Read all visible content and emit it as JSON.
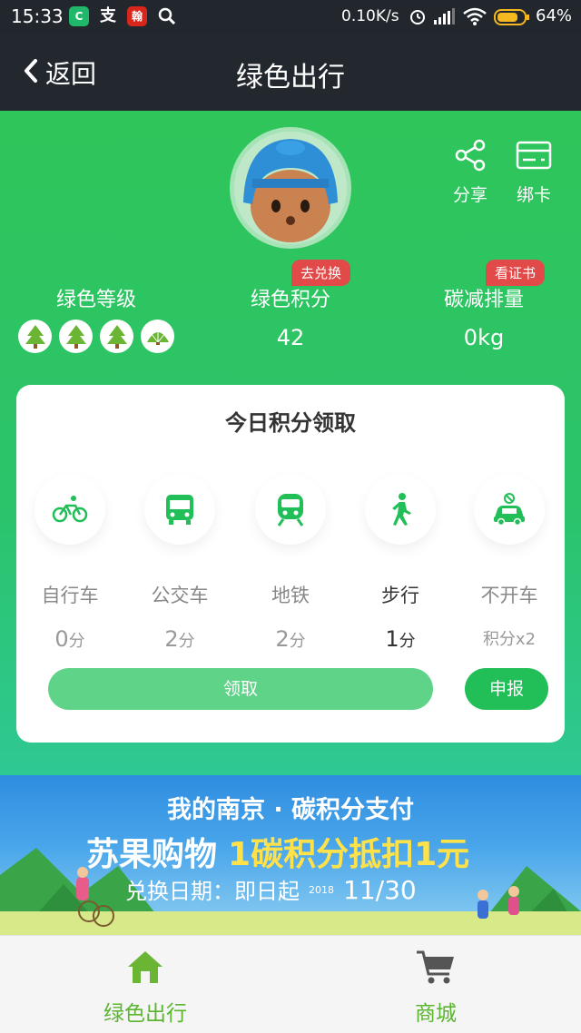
{
  "status_bar": {
    "time": "15:33",
    "app_icons": [
      "C",
      "支",
      "翰"
    ],
    "network_speed": "0.10K/s",
    "battery": "64%"
  },
  "header": {
    "back_label": "返回",
    "title": "绿色出行"
  },
  "profile": {
    "share_label": "分享",
    "bind_card_label": "绑卡"
  },
  "stats": {
    "level_label": "绿色等级",
    "points_label": "绿色积分",
    "points_value": "42",
    "points_tag": "去兑换",
    "carbon_label": "碳减排量",
    "carbon_value": "0kg",
    "carbon_tag": "看证书"
  },
  "daily_card": {
    "title": "今日积分领取",
    "modes": [
      {
        "name": "自行车",
        "points": "0",
        "unit": "分"
      },
      {
        "name": "公交车",
        "points": "2",
        "unit": "分"
      },
      {
        "name": "地铁",
        "points": "2",
        "unit": "分"
      },
      {
        "name": "步行",
        "points": "1",
        "unit": "分"
      },
      {
        "name": "不开车",
        "points": "积分x2",
        "unit": ""
      }
    ],
    "claim_label": "领取",
    "report_label": "申报"
  },
  "banner": {
    "line1": "我的南京 · 碳积分支付",
    "line2_prefix": "苏果购物",
    "line2_highlight": "1碳积分抵扣1元",
    "line3_prefix": "兑换日期：即日起",
    "line3_year": "2018",
    "line3_date": "11/30"
  },
  "bottom_nav": {
    "items": [
      {
        "label": "绿色出行",
        "color": "#5cb531"
      },
      {
        "label": "商城",
        "color": "#5cb531"
      }
    ]
  },
  "colors": {
    "accent_green": "#22bf58",
    "tag_red": "#e24a4a",
    "header_dark": "#23272e"
  }
}
